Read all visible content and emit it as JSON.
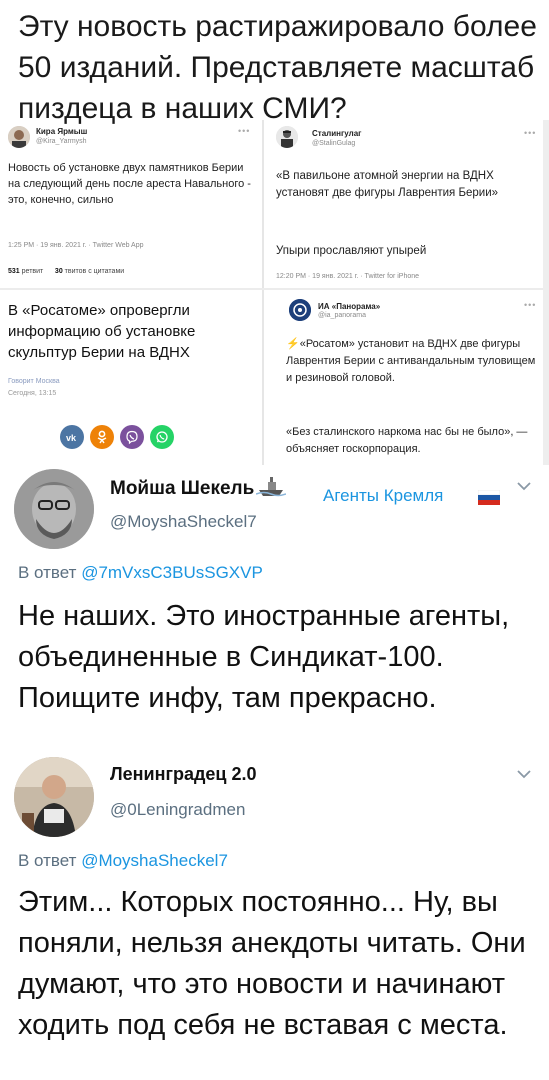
{
  "headline": "Эту новость растиражировало более 50 изданий. Представляете масштаб пиздеца в наших СМИ?",
  "tweet_kira": {
    "name": "Кира Ярмыш",
    "handle": "@Kira_Yarmysh",
    "more": "•••",
    "text": "Новость об установке двух памятников Берии на следующий день после ареста Навального - это, конечно, сильно",
    "meta": "1:25 PM · 19 янв. 2021 г. · Twitter Web App",
    "retweets": "531",
    "retweets_label": "ретвит",
    "quotes": "30",
    "quotes_label": "твитов с цитатами"
  },
  "tweet_stalin": {
    "name": "Сталингулаг",
    "handle": "@StalinGulag",
    "more": "•••",
    "text1": "«В павильоне атомной энергии на ВДНХ установят две фигуры Лаврентия Берии»",
    "text2": "Упыри прославляют упырей",
    "meta": "12:20 PM · 19 янв. 2021 г. · Twitter for iPhone"
  },
  "article": {
    "title": "В «Росатоме» опровергли информацию об установке скульптур Берии на ВДНХ",
    "source": "Говорит Москва",
    "time": "Сегодня, 13:15",
    "share_icons": [
      "vk-icon",
      "ok-icon",
      "viber-icon",
      "whatsapp-icon"
    ]
  },
  "tweet_panorama": {
    "name": "ИА «Панорама»",
    "handle": "@ia_panorama",
    "more": "•••",
    "text1": "⚡«Росатом» установит на ВДНХ две фигуры Лаврентия Берии с антивандальным туловищем и резиновой головой.",
    "text2": "«Без сталинского наркома нас бы не было», — объясняет госкорпорация."
  },
  "tweet_moysha": {
    "name": "Мойша Шекель",
    "badge_icon": "ship-emoji-icon",
    "tag": "Агенты Кремля",
    "tag_flag": "russia-flag-icon",
    "handle": "@MoyshaSheckel7",
    "reply_prefix": "В ответ",
    "reply_to": "@7mVxsC3BUsSGXVP",
    "text": "Не наших. Это иностранные агенты, объединенные в Синдикат-100. Поищите инфу, там прекрасно."
  },
  "tweet_leningradets": {
    "name": "Ленинградец 2.0",
    "handle": "@0Leningradmen",
    "reply_prefix": "В ответ",
    "reply_to": "@MoyshaSheckel7",
    "text": "Этим... Которых постоянно... Ну, вы поняли, нельзя анекдоты читать. Они думают, что это новости и начинают ходить под себя не вставая с места."
  },
  "colors": {
    "link": "#1b95e0",
    "muted": "#5b6f80",
    "vk": "#4c75a3",
    "ok": "#ee8208",
    "viber": "#7b519d",
    "whatsapp": "#25d366"
  }
}
